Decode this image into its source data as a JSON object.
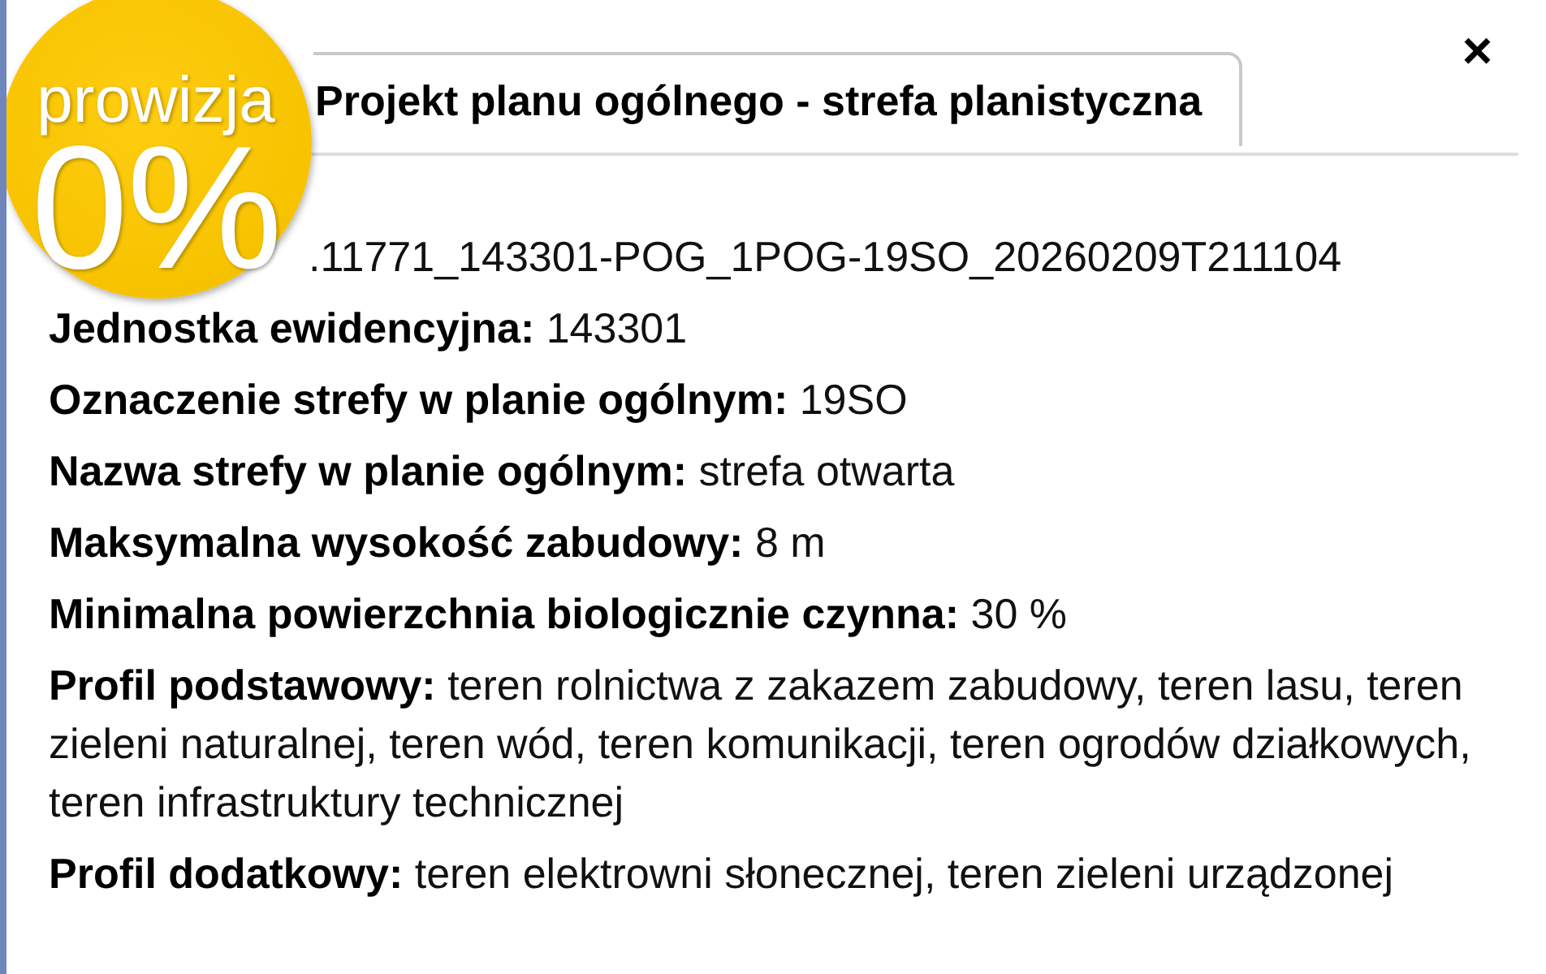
{
  "badge": {
    "caption": "prowizja",
    "rate": "0%"
  },
  "tabs": [
    {
      "label": "Projekt planu ogólnego - strefa planistyczna",
      "selected": true
    }
  ],
  "close_button": {
    "label": "×"
  },
  "identifier_fragment": ".11771_143301-POG_1POG-19SO_20260209T211104",
  "attributes": [
    {
      "text": "**Jednostka ewidencyjna:** 143301"
    },
    {
      "text": "**Oznaczenie strefy w planie ogólnym:** 19SO"
    },
    {
      "text": "**Nazwa strefy w planie ogólnym:** strefa otwarta"
    },
    {
      "text": "**Maksymalna wysokość zabudowy:** 8 m"
    },
    {
      "text": "**Minimalna powierzchnia biologicznie czynna:** 30 %"
    },
    {
      "text": "**Profil podstawowy:** teren rolnictwa z zakazem zabudowy, teren lasu, teren zieleni naturalnej, teren wód, teren komunikacji, teren ogrodów działkowych, teren infrastruktury technicznej"
    },
    {
      "text": "**Profil dodatkowy:** teren elektrowni słonecznej, teren zieleni urządzonej"
    }
  ]
}
